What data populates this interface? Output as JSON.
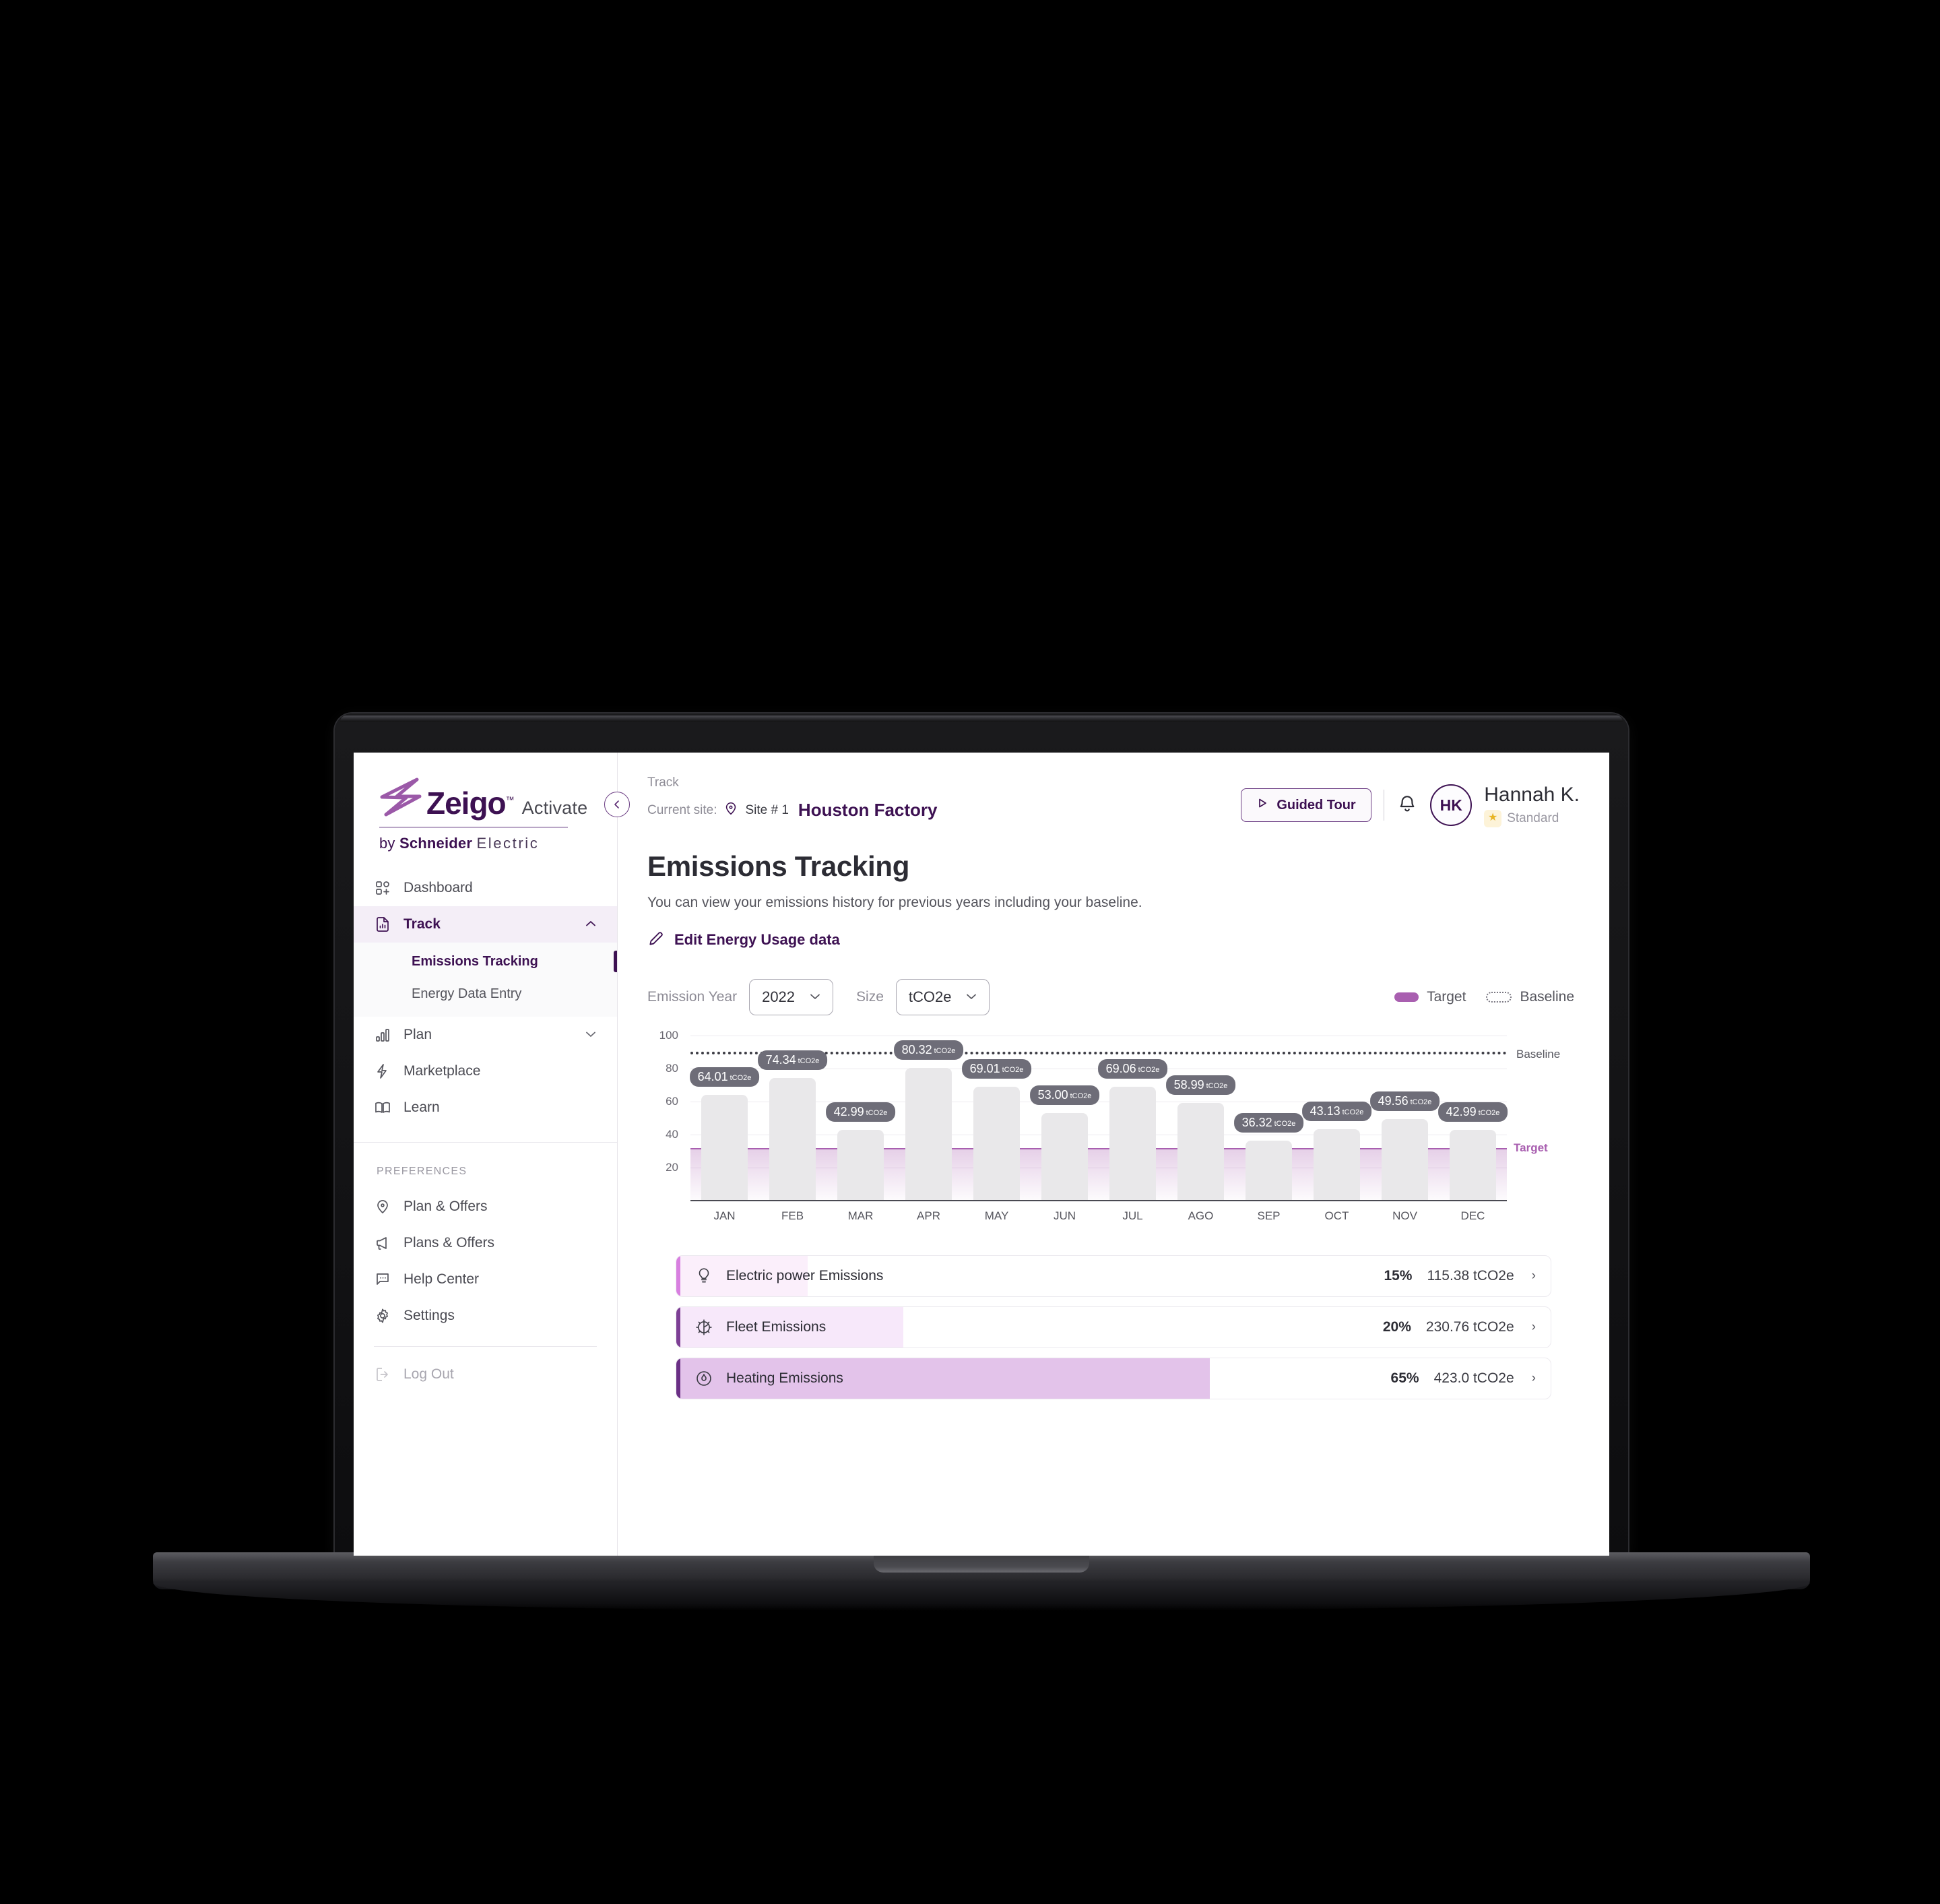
{
  "brand": {
    "name": "Zeigo",
    "tm": "™",
    "product": "Activate",
    "by_prefix": "by ",
    "by_bold": "Schneider",
    "by_spaced": "Electric"
  },
  "sidebar": {
    "collapse_icon": "chevron-left-icon",
    "nav": [
      {
        "label": "Dashboard",
        "icon": "dashboard-icon",
        "active": false,
        "chevron": ""
      },
      {
        "label": "Track",
        "icon": "document-chart-icon",
        "active": true,
        "chevron": "⌃"
      },
      {
        "label": "Plan",
        "icon": "bar-chart-icon",
        "active": false,
        "chevron": "⌄"
      },
      {
        "label": "Marketplace",
        "icon": "lightning-icon",
        "active": false,
        "chevron": ""
      },
      {
        "label": "Learn",
        "icon": "book-icon",
        "active": false,
        "chevron": ""
      }
    ],
    "subnav": [
      {
        "label": "Emissions Tracking",
        "active": true
      },
      {
        "label": "Energy Data Entry",
        "active": false
      }
    ],
    "preferences_label": "PREFERENCES",
    "preferences": [
      {
        "label": "Plan & Offers",
        "icon": "map-pin-icon"
      },
      {
        "label": "Plans & Offers",
        "icon": "megaphone-icon"
      },
      {
        "label": "Help Center",
        "icon": "chat-bubble-icon"
      },
      {
        "label": "Settings",
        "icon": "gear-icon"
      }
    ],
    "logout": {
      "label": "Log Out",
      "icon": "logout-icon"
    }
  },
  "header": {
    "breadcrumb": "Track",
    "current_site_label": "Current site:",
    "site_pin_icon": "map-pin-icon",
    "site_number": "Site # 1",
    "site_name": "Houston Factory",
    "guided_tour": "Guided Tour",
    "guided_tour_icon": "play-icon",
    "bell_icon": "bell-icon",
    "avatar_initials": "HK",
    "user_name": "Hannah K.",
    "user_plan": "Standard",
    "star_icon": "star-icon"
  },
  "page": {
    "title": "Emissions Tracking",
    "subtitle": "You can view your emissions history for previous years including your baseline.",
    "edit_link": "Edit Energy Usage data",
    "edit_icon": "pencil-icon"
  },
  "filters": {
    "year_label": "Emission Year",
    "year_value": "2022",
    "size_label": "Size",
    "size_value": "tCO2e",
    "chevron_icon": "chevron-down-icon"
  },
  "legend": {
    "target": "Target",
    "baseline": "Baseline"
  },
  "chart_data": {
    "type": "bar",
    "title": "Emissions Tracking",
    "xlabel": "",
    "ylabel": "",
    "unit": "tCO2e",
    "ylim": [
      0,
      100
    ],
    "yticks": [
      20,
      40,
      60,
      80,
      100
    ],
    "grid": true,
    "categories": [
      "JAN",
      "FEB",
      "MAR",
      "APR",
      "MAY",
      "JUN",
      "JUL",
      "AGO",
      "SEP",
      "OCT",
      "NOV",
      "DEC"
    ],
    "values": [
      64.01,
      74.34,
      42.99,
      80.32,
      69.01,
      53.0,
      69.06,
      58.99,
      36.32,
      43.13,
      49.56,
      42.99
    ],
    "labels": [
      "64.01",
      "74.34",
      "42.99",
      "80.32",
      "69.01",
      "53.00",
      "69.06",
      "58.99",
      "36.32",
      "43.13",
      "49.56",
      "42.99"
    ],
    "baseline": {
      "value": 90,
      "label": "Baseline"
    },
    "target": {
      "value": 32,
      "label": "Target"
    },
    "bar_color": "#e9e8ea",
    "target_color": "#a95fb0",
    "baseline_color": "#3c3c44",
    "legend_position": "top-right"
  },
  "breakdown": [
    {
      "name": "Electric power Emissions",
      "icon": "lightbulb-icon",
      "percent": "15%",
      "value": "115.38 tCO2e",
      "fill_pct": 15,
      "fill_color": "#fbeffb",
      "accent_color": "#d87fe0",
      "chevron": "›"
    },
    {
      "name": "Fleet Emissions",
      "icon": "fleet-gear-icon",
      "percent": "20%",
      "value": "230.76 tCO2e",
      "fill_pct": 26,
      "fill_color": "#f7e8fa",
      "accent_color": "#7d3f95",
      "chevron": "›"
    },
    {
      "name": "Heating Emissions",
      "icon": "flame-icon",
      "percent": "65%",
      "value": "423.0 tCO2e",
      "fill_pct": 61,
      "fill_color": "#e3c3ea",
      "accent_color": "#6a2f85",
      "chevron": "›"
    }
  ],
  "colors": {
    "brand_purple": "#3d1152",
    "accent": "#a95fb0",
    "bar_gray": "#e9e8ea"
  }
}
